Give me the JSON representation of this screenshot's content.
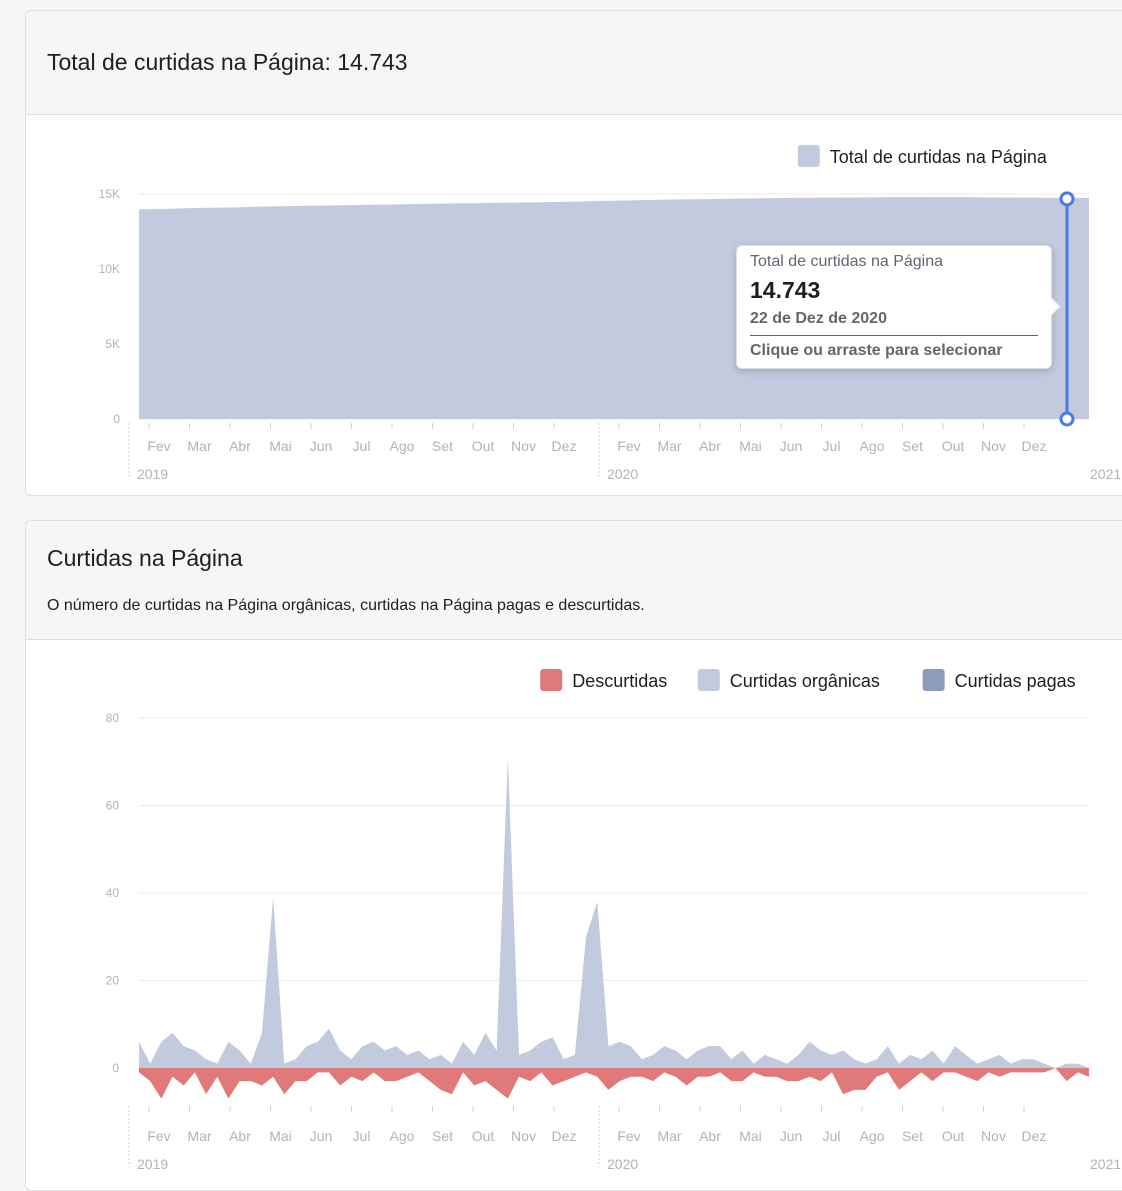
{
  "card1": {
    "title": "Total de curtidas na Página: 14.743",
    "tooltip": {
      "label": "Total de curtidas na Página",
      "value": "14.743",
      "date": "22 de Dez de 2020",
      "action": "Clique ou arraste para selecionar"
    }
  },
  "card2": {
    "title": "Curtidas na Página",
    "subtitle": "O número de curtidas na Página orgânicas, curtidas na Página pagas e descurtidas."
  },
  "colors": {
    "area_total": "#c2cadd",
    "organic": "#c2cadd",
    "paid": "#8d9bbd",
    "unlikes": "#e07a7a",
    "selector": "#4a7be0",
    "grid": "#e9ebee"
  },
  "chart_data": [
    {
      "type": "area",
      "x_start": "2019-01-01",
      "x_end": "2020-12-22",
      "x_unit": "week",
      "ylim": [
        0,
        15000
      ],
      "yticks": [
        "0",
        "5K",
        "10K",
        "15K"
      ],
      "month_labels": [
        "Fev",
        "Mar",
        "Abr",
        "Mai",
        "Jun",
        "Jul",
        "Ago",
        "Set",
        "Out",
        "Nov",
        "Dez"
      ],
      "year_labels": [
        "2019",
        "2020",
        "2021"
      ],
      "legend": [
        "Total de curtidas na Página"
      ],
      "series": [
        {
          "name": "Total de curtidas na Página",
          "values": [
            13980,
            14000,
            14050,
            14080,
            14100,
            14150,
            14180,
            14210,
            14230,
            14250,
            14280,
            14300,
            14330,
            14360,
            14380,
            14400,
            14420,
            14440,
            14470,
            14500,
            14540,
            14570,
            14600,
            14630,
            14650,
            14670,
            14700,
            14720,
            14740,
            14750,
            14760,
            14770,
            14780,
            14790,
            14800,
            14790,
            14780,
            14770,
            14760,
            14750,
            14745,
            14743
          ]
        }
      ],
      "selected": {
        "date": "2020-12-22",
        "value": 14743
      }
    },
    {
      "type": "area",
      "x_start": "2019-01-01",
      "x_end": "2020-12-31",
      "x_unit": "week",
      "ylim": [
        -10,
        80
      ],
      "yticks": [
        "0",
        "20",
        "40",
        "60",
        "80"
      ],
      "month_labels": [
        "Fev",
        "Mar",
        "Abr",
        "Mai",
        "Jun",
        "Jul",
        "Ago",
        "Set",
        "Out",
        "Nov",
        "Dez"
      ],
      "year_labels": [
        "2019",
        "2020",
        "2021"
      ],
      "legend": [
        "Descurtidas",
        "Curtidas orgânicas",
        "Curtidas pagas"
      ],
      "series": [
        {
          "name": "Curtidas orgânicas",
          "values": [
            6,
            1,
            6,
            8,
            5,
            4,
            2,
            1,
            6,
            4,
            1,
            8,
            39,
            1,
            2,
            5,
            6,
            9,
            4,
            2,
            5,
            6,
            4,
            5,
            3,
            4,
            2,
            3,
            1,
            6,
            3,
            8,
            4,
            71,
            3,
            4,
            6,
            7,
            2,
            3,
            30,
            38,
            5,
            6,
            5,
            2,
            3,
            5,
            4,
            2,
            4,
            5,
            5,
            2,
            4,
            1,
            3,
            2,
            1,
            3,
            6,
            4,
            3,
            4,
            2,
            1,
            2,
            5,
            1,
            3,
            2,
            4,
            1,
            5,
            3,
            1,
            2,
            3,
            1,
            2,
            2,
            1,
            0,
            1,
            1,
            0
          ]
        },
        {
          "name": "Curtidas pagas",
          "values": [
            0,
            0,
            0,
            0,
            0,
            0,
            0,
            0,
            0,
            0,
            0,
            0,
            0,
            0,
            0,
            0,
            0,
            0,
            0,
            0,
            0,
            0,
            0,
            0,
            0,
            0,
            0,
            0,
            0,
            0,
            0,
            0,
            0,
            0,
            0,
            0,
            0,
            0,
            0,
            0,
            0,
            0,
            0,
            0,
            0,
            0,
            0,
            0,
            0,
            0,
            0,
            0,
            0,
            0,
            0,
            0,
            0,
            0,
            0,
            0,
            0,
            0,
            0,
            0,
            0,
            0,
            0,
            0,
            0,
            0,
            0,
            0,
            0,
            0,
            0,
            0,
            0,
            0,
            0,
            0,
            0,
            0,
            0,
            0,
            0,
            0
          ]
        },
        {
          "name": "Descurtidas",
          "values": [
            -1,
            -3,
            -7,
            -2,
            -4,
            -1,
            -6,
            -2,
            -7,
            -3,
            -3,
            -4,
            -2,
            -6,
            -3,
            -3,
            -1,
            -1,
            -4,
            -2,
            -3,
            -1,
            -3,
            -3,
            -2,
            -1,
            -3,
            -5,
            -6,
            -1,
            -4,
            -3,
            -5,
            -7,
            -2,
            -3,
            -1,
            -4,
            -3,
            -2,
            -1,
            -2,
            -5,
            -3,
            -2,
            -2,
            -3,
            -1,
            -2,
            -4,
            -2,
            -2,
            -1,
            -3,
            -3,
            -1,
            -2,
            -2,
            -3,
            -3,
            -2,
            -3,
            -1,
            -6,
            -5,
            -5,
            -2,
            -1,
            -5,
            -3,
            -1,
            -3,
            -1,
            -1,
            -2,
            -3,
            -1,
            -2,
            -1,
            -1,
            -1,
            -1,
            0,
            -3,
            -1,
            -2
          ]
        }
      ]
    }
  ]
}
